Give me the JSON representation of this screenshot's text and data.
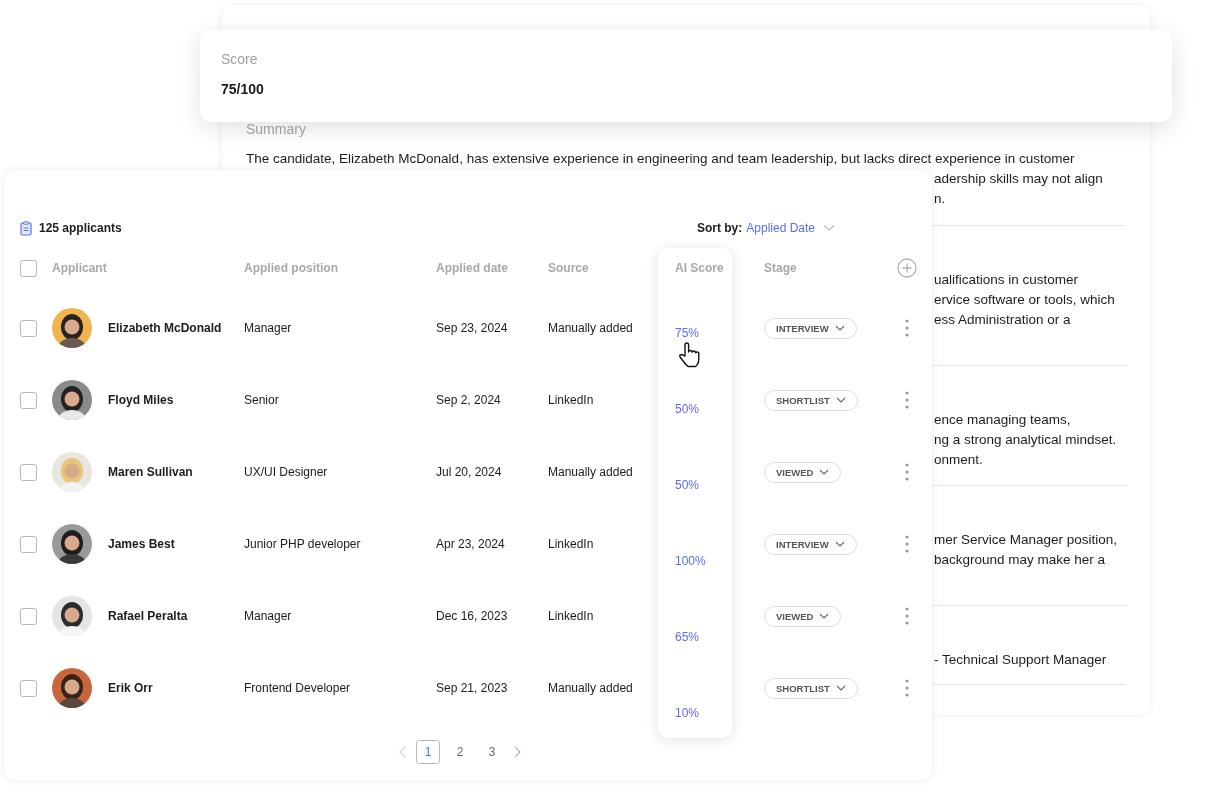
{
  "score_card": {
    "label": "Score",
    "value": "75/100"
  },
  "evaluation": {
    "summary_label": "Summary",
    "summary_lines": [
      "The candidate, Elizabeth McDonald, has extensive experience in engineering and team leadership, but lacks direct experience in customer",
      "adership skills may not align",
      "n."
    ],
    "sections": [
      {
        "lines": [
          "ualifications in customer",
          "ervice software or tools, which",
          "ess Administration or a"
        ]
      },
      {
        "lines": [
          "ence managing teams,",
          "ng a strong analytical mindset.",
          "onment."
        ]
      },
      {
        "lines": [
          "mer Service Manager position,",
          "background may make her a"
        ]
      },
      {
        "lines": [
          "- Technical Support Manager"
        ]
      }
    ]
  },
  "applicants": {
    "count": "125 applicants",
    "sort_label": "Sort by:",
    "sort_value": "Applied Date",
    "all_checked": false,
    "columns": [
      "Applicant",
      "Applied position",
      "Applied date",
      "Source",
      "AI Score",
      "Stage"
    ],
    "rows": [
      {
        "name": "Elizabeth McDonald",
        "position": "Manager",
        "date": "Sep 23, 2024",
        "source": "Manually added",
        "ai_score": "75%",
        "stage": "INTERVIEW",
        "checked": false
      },
      {
        "name": "Floyd Miles",
        "position": "Senior",
        "date": "Sep 2, 2024",
        "source": "LinkedIn",
        "ai_score": "50%",
        "stage": "SHORTLIST",
        "checked": false
      },
      {
        "name": "Maren Sullivan",
        "position": "UX/UI Designer",
        "date": "Jul 20, 2024",
        "source": "Manually added",
        "ai_score": "50%",
        "stage": "VIEWED",
        "checked": false
      },
      {
        "name": "James Best",
        "position": "Junior PHP developer",
        "date": "Apr 23, 2024",
        "source": "LinkedIn",
        "ai_score": "100%",
        "stage": "INTERVIEW",
        "checked": false
      },
      {
        "name": "Rafael Peralta",
        "position": "Manager",
        "date": "Dec 16, 2023",
        "source": "LinkedIn",
        "ai_score": "65%",
        "stage": "VIEWED",
        "checked": false
      },
      {
        "name": "Erik Orr",
        "position": "Frontend Developer",
        "date": "Sep 21, 2023",
        "source": "Manually added",
        "ai_score": "10%",
        "stage": "SHORTLIST",
        "checked": false
      }
    ],
    "pagination": {
      "pages": [
        {
          "label": "1",
          "selected": true
        },
        {
          "label": "2",
          "selected": false
        },
        {
          "label": "3",
          "selected": false
        }
      ]
    }
  }
}
